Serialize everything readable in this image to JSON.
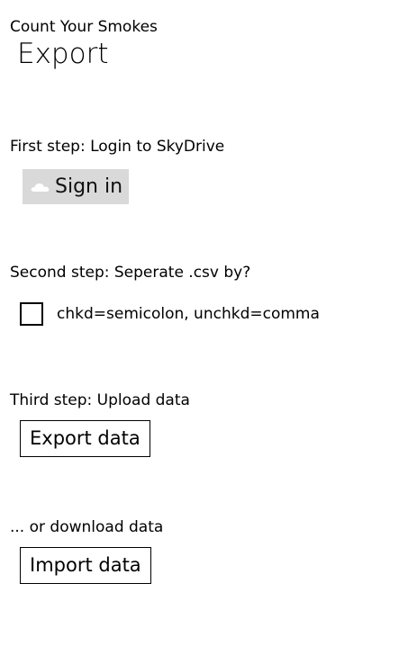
{
  "header": {
    "app_title": "Count Your Smokes",
    "page_title": "Export"
  },
  "steps": {
    "login_label": "First step: Login to SkyDrive",
    "signin_label": "Sign in",
    "separator_label": "Second step: Seperate .csv by?",
    "checkbox_label": "chkd=semicolon, unchkd=comma",
    "checkbox_checked": false,
    "upload_label": "Third step: Upload data",
    "export_button_label": "Export data",
    "download_label": "... or download data",
    "import_button_label": "Import data"
  },
  "icons": {
    "signin": "cloud-icon"
  },
  "colors": {
    "signin_background": "#d9d9d9",
    "cloud": "#ffffff"
  }
}
